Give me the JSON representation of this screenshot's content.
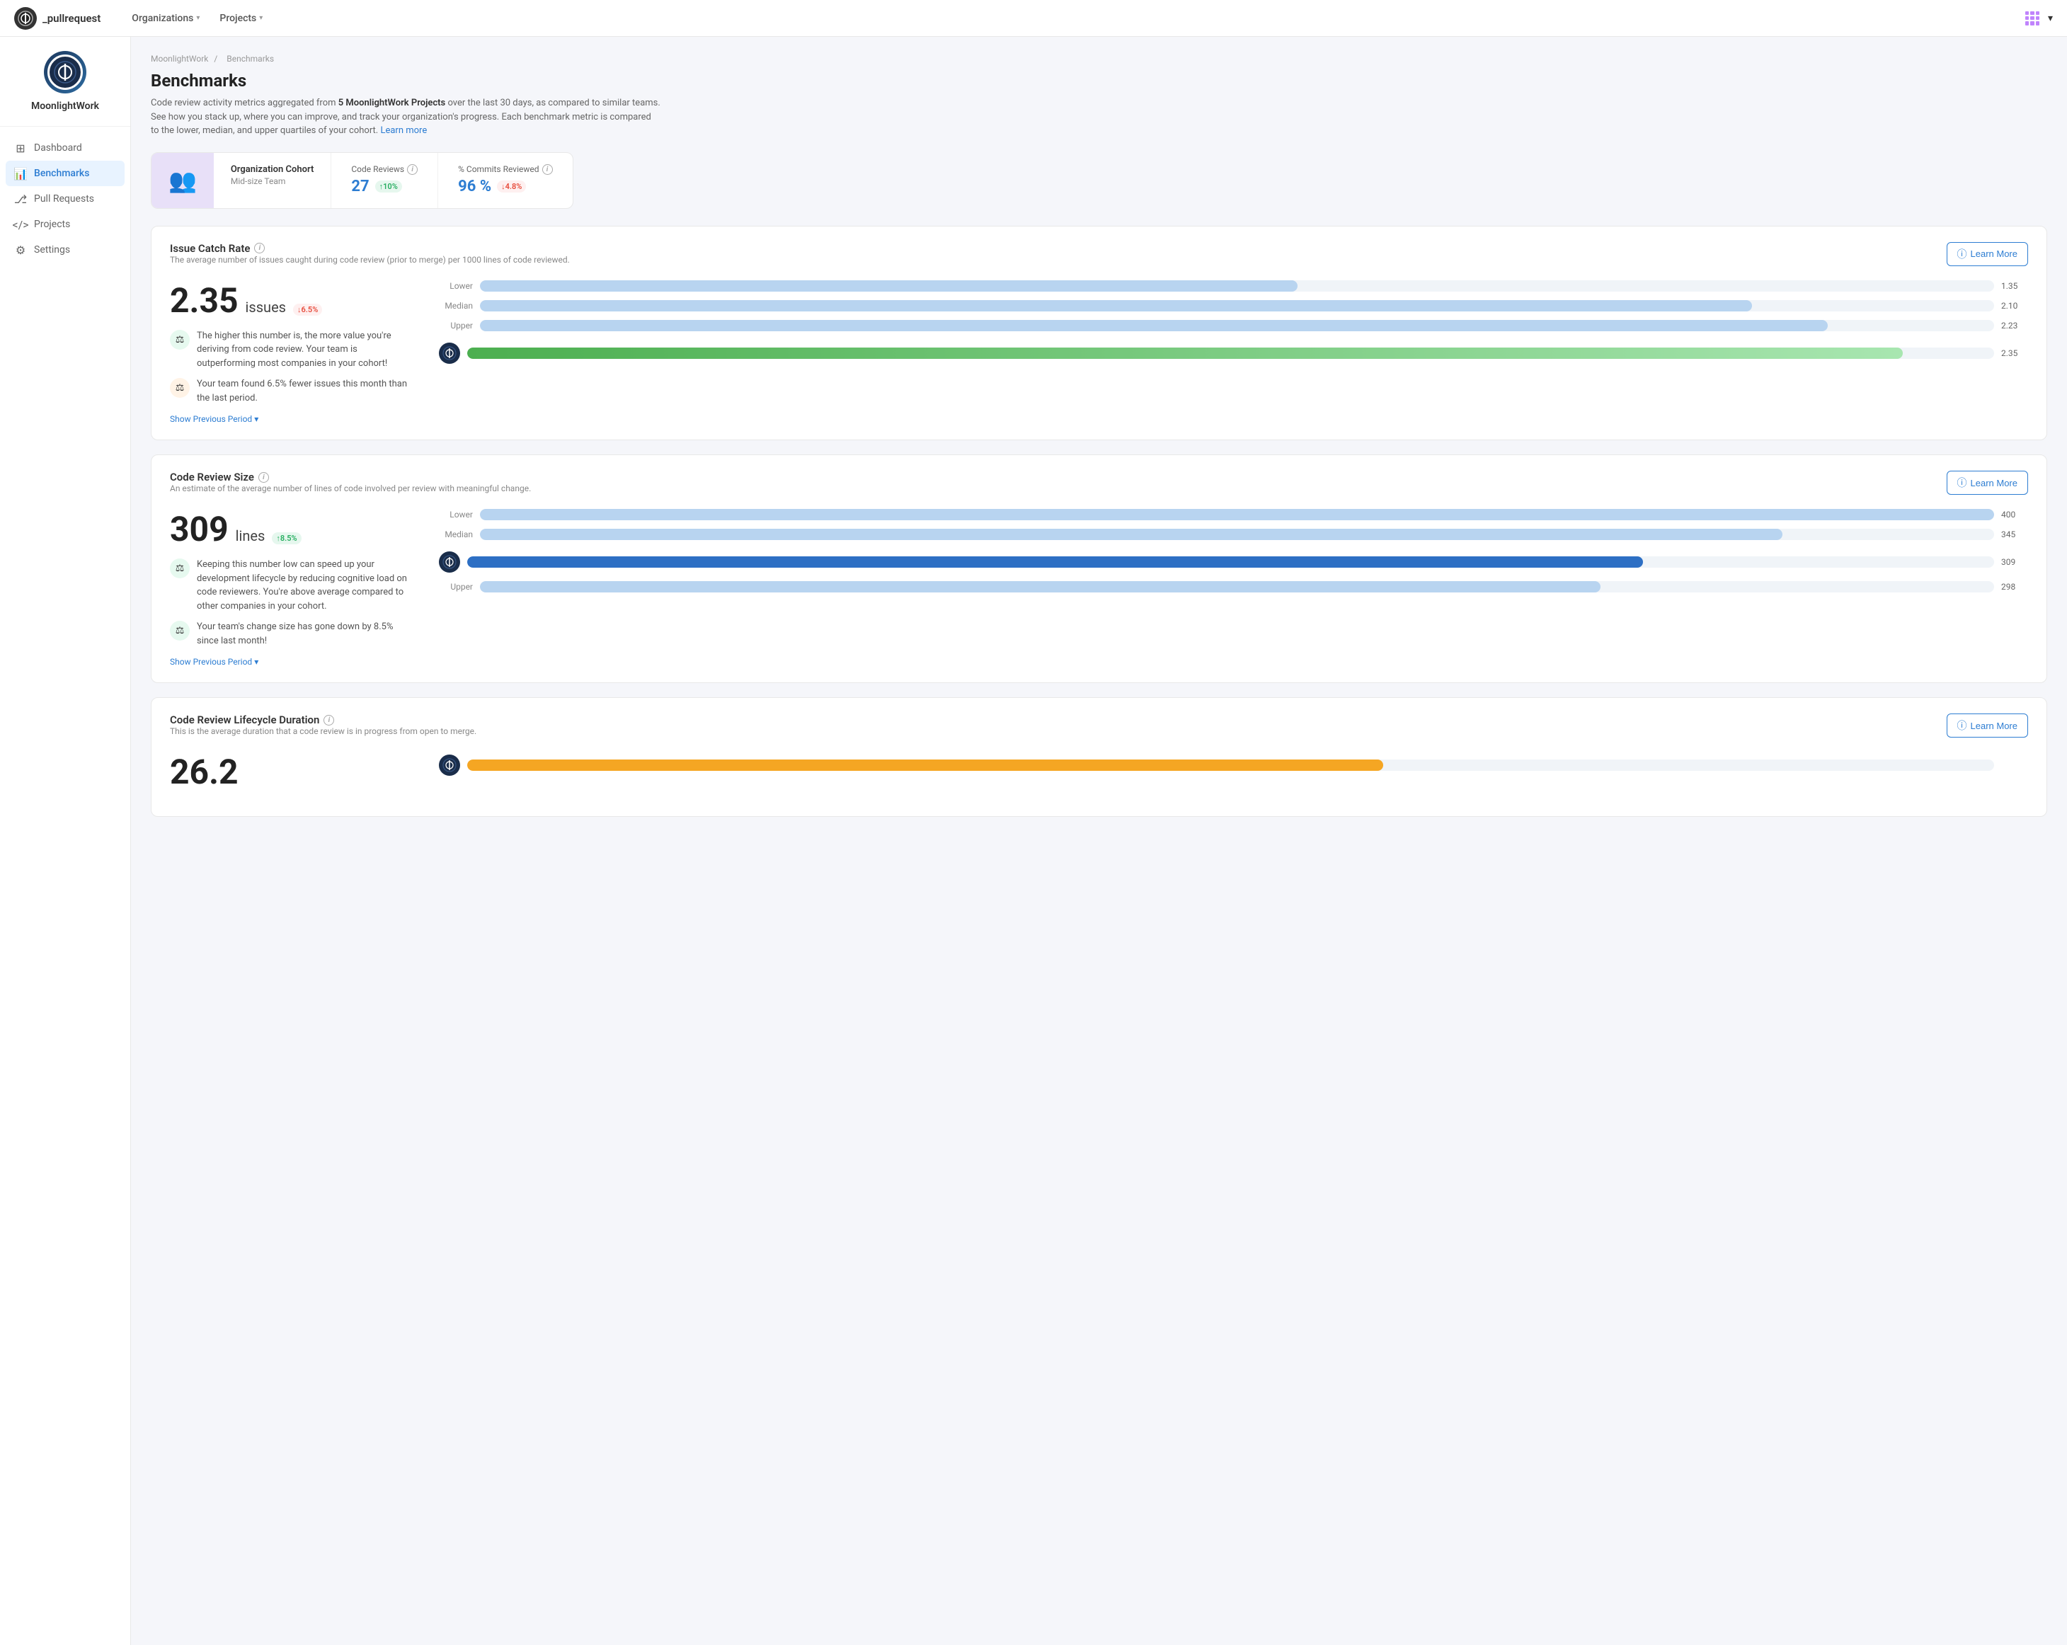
{
  "app": {
    "logo_text": "_pullrequest",
    "org_name": "MoonlightWork"
  },
  "top_nav": {
    "organizations_label": "Organizations",
    "projects_label": "Projects"
  },
  "sidebar": {
    "org_name": "MoonlightWork",
    "items": [
      {
        "id": "dashboard",
        "label": "Dashboard",
        "icon": "⊞",
        "active": false
      },
      {
        "id": "benchmarks",
        "label": "Benchmarks",
        "icon": "📈",
        "active": true
      },
      {
        "id": "pull-requests",
        "label": "Pull Requests",
        "icon": "⎇",
        "active": false
      },
      {
        "id": "projects",
        "label": "Projects",
        "icon": "</>",
        "active": false
      },
      {
        "id": "settings",
        "label": "Settings",
        "icon": "⚙",
        "active": false
      }
    ]
  },
  "breadcrumb": {
    "org": "MoonlightWork",
    "page": "Benchmarks",
    "separator": "/"
  },
  "page": {
    "title": "Benchmarks",
    "description_1": "Code review activity metrics aggregated from ",
    "description_highlight": "5 MoonlightWork Projects",
    "description_2": " over the last 30 days, as compared to similar teams. See how you stack up, where you can improve, and track your organization's progress. Each benchmark metric is compared to the lower, median, and upper quartiles of your cohort.",
    "learn_more_link": "Learn more"
  },
  "cohort": {
    "icon": "👥",
    "label": "Organization Cohort",
    "sub": "Mid-size Team",
    "code_reviews_label": "Code Reviews",
    "code_reviews_value": "27",
    "code_reviews_badge": "↑10%",
    "commits_label": "% Commits Reviewed",
    "commits_value": "96 %",
    "commits_badge": "↓4.8%"
  },
  "metrics": [
    {
      "id": "issue-catch-rate",
      "title": "Issue Catch Rate",
      "description": "The average number of issues caught during code review (prior to merge) per 1000 lines of code reviewed.",
      "learn_more": "Learn More",
      "main_value": "2.35",
      "unit": "issues",
      "badge": "↓6.5%",
      "badge_type": "down",
      "insights": [
        {
          "icon_type": "green",
          "icon": "⚖",
          "text": "The higher this number is, the more value you're deriving from code review. Your team is outperforming most companies in your cohort!"
        },
        {
          "icon_type": "orange",
          "icon": "⚖",
          "text": "Your team found 6.5% fewer issues this month than the last period."
        }
      ],
      "show_prev": "Show Previous Period",
      "bars": [
        {
          "label": "Lower",
          "value": "1.35",
          "pct": 54,
          "type": "light-blue"
        },
        {
          "label": "Median",
          "value": "2.10",
          "pct": 84,
          "type": "light-blue"
        },
        {
          "label": "Upper",
          "value": "2.23",
          "pct": 89,
          "type": "light-blue"
        }
      ],
      "org_bar": {
        "value": "2.35",
        "pct": 94,
        "type": "green"
      }
    },
    {
      "id": "code-review-size",
      "title": "Code Review Size",
      "description": "An estimate of the average number of lines of code involved per review with meaningful change.",
      "learn_more": "Learn More",
      "main_value": "309",
      "unit": "lines",
      "badge": "↑8.5%",
      "badge_type": "up",
      "insights": [
        {
          "icon_type": "green",
          "icon": "⚖",
          "text": "Keeping this number low  can speed up your development lifecycle by reducing cognitive load on code reviewers. You're above average compared to other companies in your cohort."
        },
        {
          "icon_type": "green",
          "icon": "⚖",
          "text": "Your team's change size has gone down by 8.5% since last month!"
        }
      ],
      "show_prev": "Show Previous Period",
      "bars": [
        {
          "label": "Lower",
          "value": "400",
          "pct": 100,
          "type": "light-blue"
        },
        {
          "label": "Median",
          "value": "345",
          "pct": 86,
          "type": "light-blue"
        },
        {
          "label": "Upper",
          "value": "298",
          "pct": 74,
          "type": "light-blue"
        }
      ],
      "org_bar": {
        "value": "309",
        "pct": 77,
        "type": "dark-blue"
      }
    },
    {
      "id": "code-review-lifecycle",
      "title": "Code Review Lifecycle Duration",
      "description": "This is the average duration that a code review is in progress from open to merge.",
      "learn_more": "Learn More",
      "main_value": "26.2",
      "unit": "",
      "badge": "",
      "badge_type": "",
      "insights": [],
      "show_prev": "",
      "bars": [],
      "org_bar": {
        "value": "",
        "pct": 60,
        "type": "orange"
      }
    }
  ]
}
